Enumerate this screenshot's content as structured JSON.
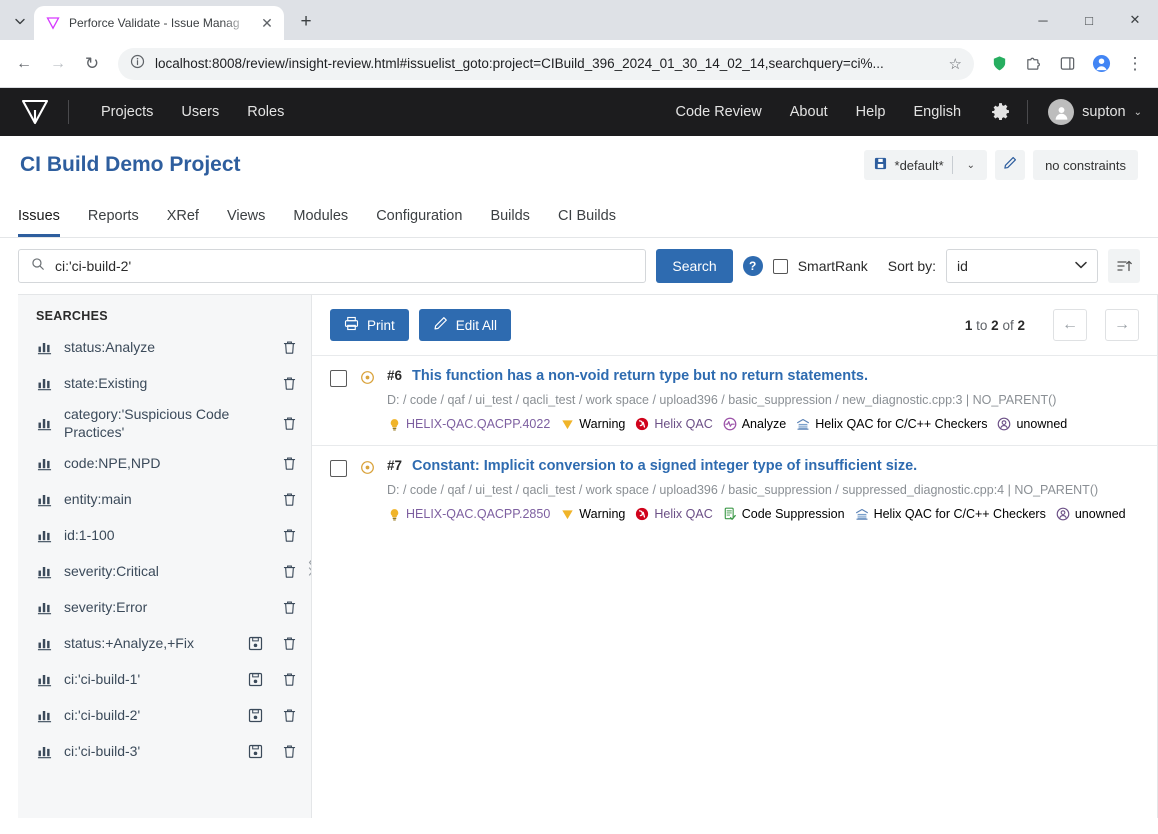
{
  "browser": {
    "tab": {
      "title": "Perforce Validate - Issue Manag",
      "favicon": "perforce-logo-icon",
      "close": "✕"
    },
    "new_tab": "+",
    "tab_list": "⌄",
    "window": {
      "minimize": "─",
      "maximize": "□",
      "close": "✕"
    },
    "nav": {
      "back": "←",
      "forward": "→",
      "reload": "↻"
    },
    "url": "localhost:8008/review/insight-review.html#issuelist_goto:project=CIBuild_396_2024_01_30_14_02_14,searchquery=ci%...",
    "star": "☆",
    "extensions_icon": "puzzle-icon",
    "shield_icon": "shield-icon",
    "split_icon": "split-screen-icon",
    "profile_icon": "profile-icon",
    "menu_icon": "⋮"
  },
  "appnav": {
    "logo": "perforce-logo-icon",
    "left_links": [
      "Projects",
      "Users",
      "Roles"
    ],
    "right_links": [
      "Code Review",
      "About",
      "Help",
      "English"
    ],
    "gear": "gear-icon",
    "user": "supton",
    "user_caret": "⌄"
  },
  "project": {
    "title": "CI Build Demo Project",
    "profile_value": "*default*",
    "profile_icon": "save-profile-icon",
    "profile_caret": "⌄",
    "edit_icon": "pencil-icon",
    "constraints": "no constraints"
  },
  "tabs": [
    {
      "label": "Issues",
      "active": true
    },
    {
      "label": "Reports",
      "active": false
    },
    {
      "label": "XRef",
      "active": false
    },
    {
      "label": "Views",
      "active": false
    },
    {
      "label": "Modules",
      "active": false
    },
    {
      "label": "Configuration",
      "active": false
    },
    {
      "label": "Builds",
      "active": false
    },
    {
      "label": "CI Builds",
      "active": false
    }
  ],
  "search": {
    "icon": "search-icon",
    "value": "ci:'ci-build-2'",
    "placeholder": "",
    "button": "Search",
    "help": "?",
    "smartrank_label": "SmartRank",
    "smartrank_checked": false,
    "sortby_label": "Sort by:",
    "sort_value": "id",
    "sort_options": [
      "id"
    ],
    "sort_direction_icon": "sort-ascending-icon"
  },
  "sidebar": {
    "header": "SEARCHES",
    "items": [
      {
        "label": "status:Analyze",
        "chart_icon": "bar-chart-icon",
        "has_save": false,
        "save_icon": "save-icon",
        "delete_icon": "trash-icon"
      },
      {
        "label": "state:Existing",
        "chart_icon": "bar-chart-icon",
        "has_save": false,
        "save_icon": "save-icon",
        "delete_icon": "trash-icon"
      },
      {
        "label": "category:'Suspicious Code Practices'",
        "chart_icon": "bar-chart-icon",
        "has_save": false,
        "save_icon": "save-icon",
        "delete_icon": "trash-icon"
      },
      {
        "label": "code:NPE,NPD",
        "chart_icon": "bar-chart-icon",
        "has_save": false,
        "save_icon": "save-icon",
        "delete_icon": "trash-icon"
      },
      {
        "label": "entity:main",
        "chart_icon": "bar-chart-icon",
        "has_save": false,
        "save_icon": "save-icon",
        "delete_icon": "trash-icon"
      },
      {
        "label": "id:1-100",
        "chart_icon": "bar-chart-icon",
        "has_save": false,
        "save_icon": "save-icon",
        "delete_icon": "trash-icon"
      },
      {
        "label": "severity:Critical",
        "chart_icon": "bar-chart-icon",
        "has_save": false,
        "save_icon": "save-icon",
        "delete_icon": "trash-icon"
      },
      {
        "label": "severity:Error",
        "chart_icon": "bar-chart-icon",
        "has_save": false,
        "save_icon": "save-icon",
        "delete_icon": "trash-icon"
      },
      {
        "label": "status:+Analyze,+Fix",
        "chart_icon": "bar-chart-icon",
        "has_save": true,
        "save_icon": "save-icon",
        "delete_icon": "trash-icon"
      },
      {
        "label": "ci:'ci-build-1'",
        "chart_icon": "bar-chart-icon",
        "has_save": true,
        "save_icon": "save-icon",
        "delete_icon": "trash-icon"
      },
      {
        "label": "ci:'ci-build-2'",
        "chart_icon": "bar-chart-icon",
        "has_save": true,
        "save_icon": "save-icon",
        "delete_icon": "trash-icon"
      },
      {
        "label": "ci:'ci-build-3'",
        "chart_icon": "bar-chart-icon",
        "has_save": true,
        "save_icon": "save-icon",
        "delete_icon": "trash-icon"
      }
    ]
  },
  "list_toolbar": {
    "print": "Print",
    "print_icon": "printer-icon",
    "edit_all": "Edit All",
    "edit_icon": "pencil-icon",
    "page_from": "1",
    "page_to": "2",
    "page_total": "2",
    "page_text_to": "to",
    "page_text_of": "of",
    "prev_icon": "←",
    "next_icon": "→"
  },
  "issues": [
    {
      "id": "#6",
      "title": "This function has a non-void return type but no return statements.",
      "state_icon": "circle-dot-icon",
      "path_segments": [
        "D:",
        "code",
        "qaf",
        "ui_test",
        "qacli_test",
        "work space",
        "upload396",
        "basic_suppression"
      ],
      "path_file": "new_diagnostic.cpp:3",
      "path_parent": "NO_PARENT()",
      "badges": [
        {
          "label": "HELIX-QAC.QACPP.4022",
          "icon": "lightbulb-icon",
          "kind": "code"
        },
        {
          "label": "Warning",
          "icon": "warning-triangle-icon",
          "kind": "severity"
        },
        {
          "label": "Helix QAC",
          "icon": "helix-qac-icon",
          "kind": "tool"
        },
        {
          "label": "Analyze",
          "icon": "pulse-circle-icon",
          "kind": "status"
        },
        {
          "label": "Helix QAC for C/C++ Checkers",
          "icon": "module-icon",
          "kind": "group"
        },
        {
          "label": "unowned",
          "icon": "person-circle-icon",
          "kind": "owner"
        }
      ]
    },
    {
      "id": "#7",
      "title": "Constant: Implicit conversion to a signed integer type of insufficient size.",
      "state_icon": "circle-dot-icon",
      "path_segments": [
        "D:",
        "code",
        "qaf",
        "ui_test",
        "qacli_test",
        "work space",
        "upload396",
        "basic_suppression"
      ],
      "path_file": "suppressed_diagnostic.cpp:4",
      "path_parent": "NO_PARENT()",
      "badges": [
        {
          "label": "HELIX-QAC.QACPP.2850",
          "icon": "lightbulb-icon",
          "kind": "code"
        },
        {
          "label": "Warning",
          "icon": "warning-triangle-icon",
          "kind": "severity"
        },
        {
          "label": "Helix QAC",
          "icon": "helix-qac-icon",
          "kind": "tool"
        },
        {
          "label": "Code Suppression",
          "icon": "checklist-icon",
          "kind": "status"
        },
        {
          "label": "Helix QAC for C/C++ Checkers",
          "icon": "module-icon",
          "kind": "group"
        },
        {
          "label": "unowned",
          "icon": "person-circle-icon",
          "kind": "owner"
        }
      ]
    }
  ],
  "colors": {
    "accent_blue": "#2e6bb0",
    "nav_dark": "#1c1c1e",
    "title_blue": "#2e5e9e",
    "badge_purple": "#6b4f86",
    "warning_amber": "#f0a500",
    "helix_red": "#d0021b",
    "suppression_green": "#3f9a4a"
  }
}
